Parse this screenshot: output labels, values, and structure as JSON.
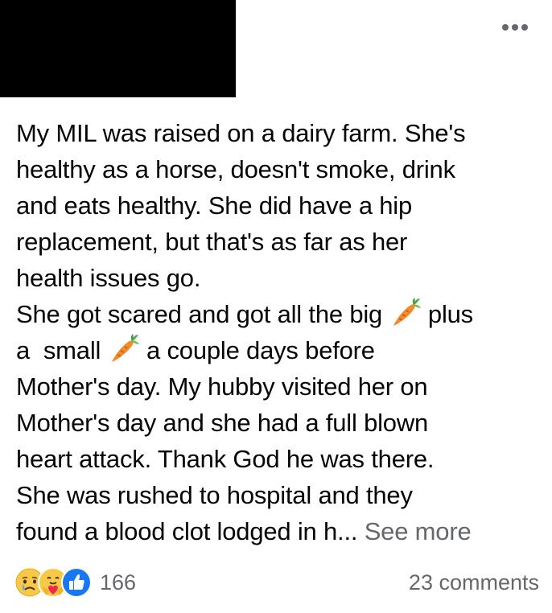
{
  "post": {
    "lines": [
      "My MIL was raised on a dairy farm. She's",
      "healthy as a horse, doesn't smoke, drink",
      "and eats healthy. She did have a hip",
      "replacement, but that's as far as her",
      "health issues go.",
      "She got scared and got all the big ",
      " plus",
      "a  small ",
      " a couple days before",
      "Mother's day. My hubby visited her on",
      "Mother's day and she had a full blown",
      "heart attack. Thank God he was there.",
      "She was rushed to hospital and they",
      "found a blood clot lodged in h... "
    ],
    "see_more": "See more"
  },
  "icons": {
    "more": "more-options-icon",
    "carrot": "carrot-emoji-icon",
    "sad": "sad-reaction-icon",
    "care": "care-reaction-icon",
    "like": "like-reaction-icon"
  },
  "colors": {
    "text": "#050505",
    "secondary": "#65676b",
    "like_blue": "#1877f2",
    "carrot": "#f28c28"
  },
  "footer": {
    "reaction_count": "166",
    "comments": "23 comments"
  }
}
